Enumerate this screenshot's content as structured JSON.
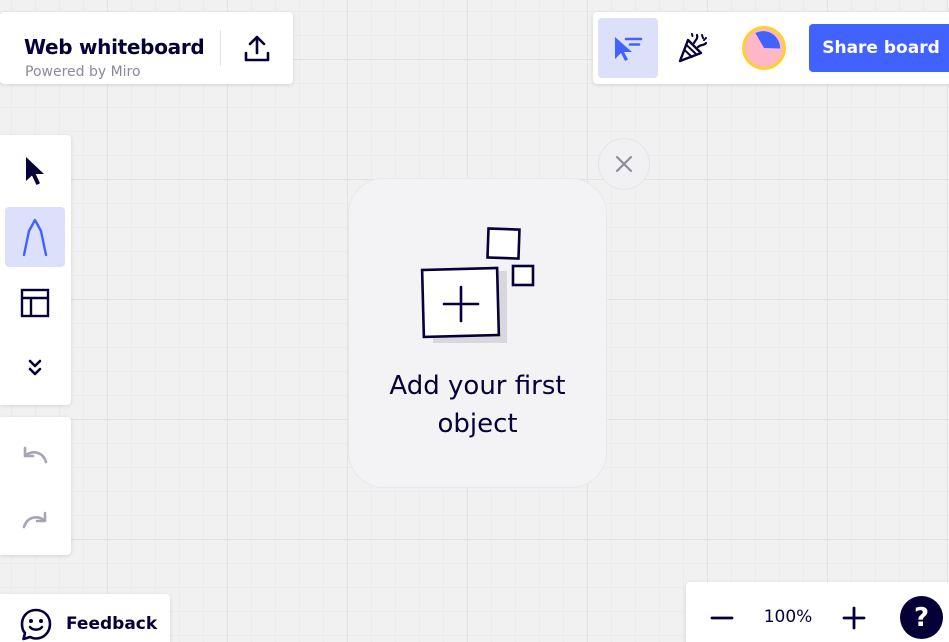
{
  "header": {
    "title": "Web whiteboard",
    "subtitle": "Powered by Miro",
    "export_icon": "upload-icon"
  },
  "top_actions": {
    "cursor_tool_icon": "cursor-lines-icon",
    "celebrate_icon": "party-popper-icon",
    "timer_icon": "timer-avatar-icon",
    "share_label": "Share board"
  },
  "left_toolbar": {
    "tools": [
      {
        "name": "select",
        "icon": "arrow-cursor-icon",
        "active": false
      },
      {
        "name": "pen",
        "icon": "pen-icon",
        "active": true
      },
      {
        "name": "templates",
        "icon": "frame-layout-icon",
        "active": false
      },
      {
        "name": "more",
        "icon": "chevron-double-down-icon",
        "active": false
      }
    ],
    "history": [
      {
        "name": "undo",
        "icon": "undo-icon",
        "enabled": false
      },
      {
        "name": "redo",
        "icon": "redo-icon",
        "enabled": false
      }
    ]
  },
  "onboarding": {
    "close_icon": "close-icon",
    "illustration_icon": "add-object-icon",
    "text_line1": "Add your first",
    "text_line2": "object"
  },
  "feedback": {
    "icon": "chat-smile-icon",
    "label": "Feedback"
  },
  "zoom": {
    "zoom_out_icon": "minus-icon",
    "level": "100%",
    "zoom_in_icon": "plus-icon",
    "help_label": "?"
  },
  "colors": {
    "accent": "#4262ff",
    "accent_soft": "#dde0fb",
    "ink": "#050038",
    "timer_ring": "#ffd02f",
    "timer_fill": "#ffb7c5",
    "timer_slice": "#4262ff",
    "disabled": "#a5a5b5"
  }
}
